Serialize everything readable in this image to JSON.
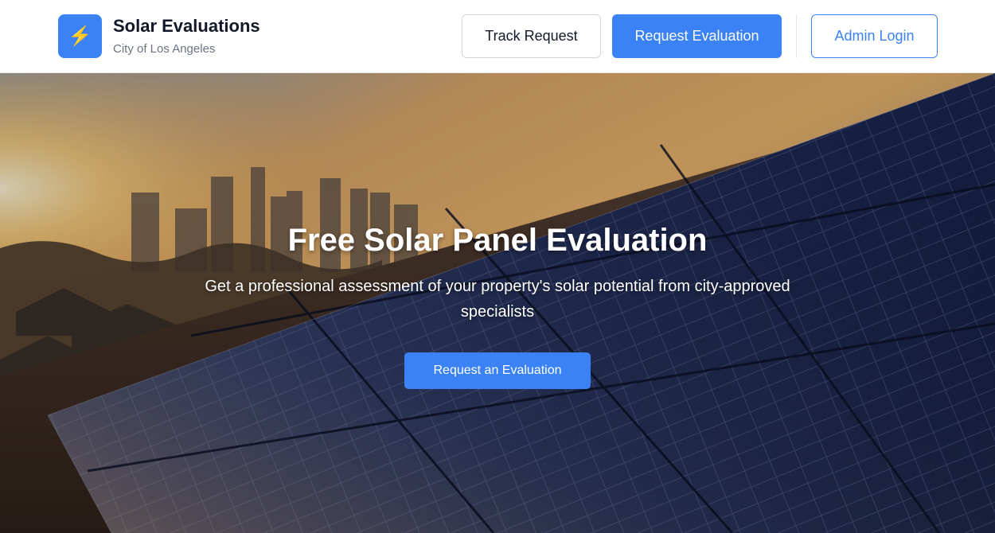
{
  "header": {
    "logo_icon": "lightning-bolt-icon",
    "title": "Solar Evaluations",
    "subtitle": "City of Los Angeles",
    "nav": {
      "track_label": "Track Request",
      "request_label": "Request Evaluation",
      "admin_label": "Admin Login"
    }
  },
  "hero": {
    "title": "Free Solar Panel Evaluation",
    "subtitle": "Get a professional assessment of your property's solar potential from city-approved specialists",
    "cta_label": "Request an Evaluation",
    "background_image": "sunset-city-skyline-with-rooftop-solar-panels"
  },
  "colors": {
    "accent": "#3b82f6",
    "logo_bolt": "#fbbf24",
    "text_dark": "#111827",
    "text_muted": "#6b7280"
  }
}
